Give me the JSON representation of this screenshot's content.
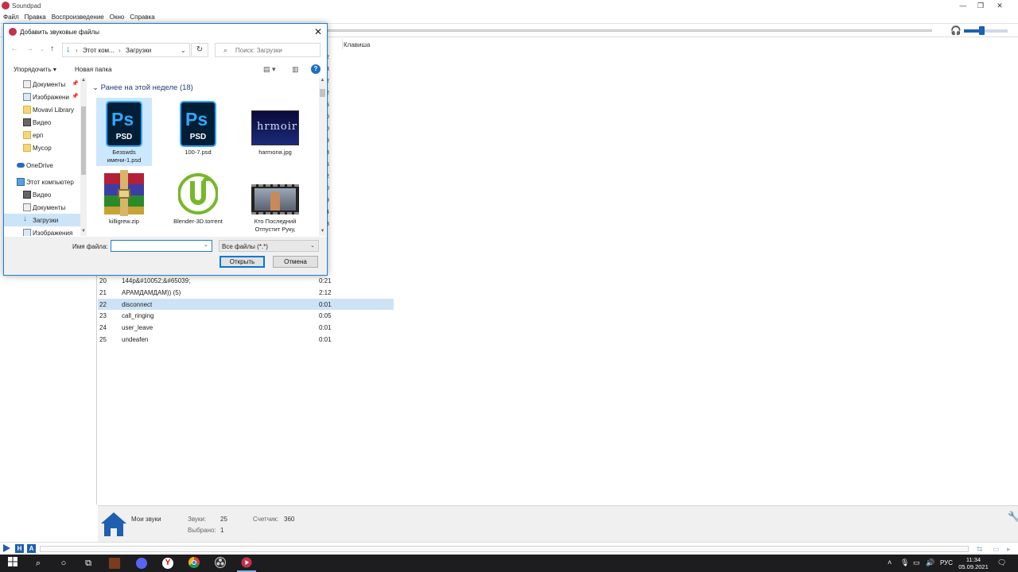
{
  "app": {
    "title": "Soundpad",
    "menu": [
      "Файл",
      "Правка",
      "Воспроизведение",
      "Окно",
      "Справка"
    ],
    "list_columns": {
      "key": "Клавиша"
    },
    "partial_durations": [
      "2",
      "3",
      "2",
      "2",
      "5",
      "0",
      "0",
      "9",
      "3",
      "5",
      "2",
      "0",
      "9",
      "4",
      "3"
    ],
    "rows": [
      {
        "num": "20",
        "name": "144p&#10052;&#65039;",
        "dur": "0:21",
        "selected": false
      },
      {
        "num": "21",
        "name": "АРАМДАМДАМ)) (5)",
        "dur": "2:12",
        "selected": false
      },
      {
        "num": "22",
        "name": "disconnect",
        "dur": "0:01",
        "selected": true
      },
      {
        "num": "23",
        "name": "call_ringing",
        "dur": "0:05",
        "selected": false
      },
      {
        "num": "24",
        "name": "user_leave",
        "dur": "0:01",
        "selected": false
      },
      {
        "num": "25",
        "name": "undeafen",
        "dur": "0:01",
        "selected": false
      }
    ],
    "status": {
      "category": "Мои звуки",
      "sounds_label": "Звуки:",
      "sounds_value": "25",
      "selected_label": "Выбрано:",
      "selected_value": "1",
      "counter_label": "Счетчик:",
      "counter_value": "360"
    },
    "volume": 0.45,
    "bottom_buttons": [
      "H",
      "A"
    ]
  },
  "dialog": {
    "title": "Добавить звуковые файлы",
    "breadcrumb": [
      "Этот ком...",
      "Загрузки"
    ],
    "search_placeholder": "Поиск: Загрузки",
    "organize": "Упорядочить",
    "new_folder": "Новая папка",
    "tree": [
      {
        "label": "Документы",
        "icon": "documents-icon",
        "indent": 1,
        "pinned": true,
        "selected": false
      },
      {
        "label": "Изображени",
        "icon": "pictures-icon",
        "indent": 1,
        "pinned": true,
        "selected": false
      },
      {
        "label": "Movavi Library",
        "icon": "folder-icon",
        "indent": 1,
        "pinned": false,
        "selected": false
      },
      {
        "label": "Видео",
        "icon": "video-icon",
        "indent": 1,
        "pinned": false,
        "selected": false
      },
      {
        "label": "ерп",
        "icon": "folder-icon",
        "indent": 1,
        "pinned": false,
        "selected": false
      },
      {
        "label": "Мусор",
        "icon": "folder-icon",
        "indent": 1,
        "pinned": false,
        "selected": false
      },
      {
        "label": "OneDrive",
        "icon": "cloud-icon",
        "indent": 0,
        "pinned": false,
        "selected": false
      },
      {
        "label": "Этот компьютер",
        "icon": "computer-icon",
        "indent": 0,
        "pinned": false,
        "selected": false
      },
      {
        "label": "Видео",
        "icon": "video-icon",
        "indent": 1,
        "pinned": false,
        "selected": false
      },
      {
        "label": "Документы",
        "icon": "documents-icon",
        "indent": 1,
        "pinned": false,
        "selected": false
      },
      {
        "label": "Загрузки",
        "icon": "downloads-icon",
        "indent": 1,
        "pinned": false,
        "selected": true
      },
      {
        "label": "Изображения",
        "icon": "pictures-icon",
        "indent": 1,
        "pinned": false,
        "selected": false
      }
    ],
    "group_header": "Ранее на этой неделе (18)",
    "files": [
      {
        "name": "Безswds имени-1.psd",
        "icon": "psd-icon",
        "selected": true
      },
      {
        "name": "100-7.psd",
        "icon": "psd-icon",
        "selected": false
      },
      {
        "name": "harmonя.jpg",
        "icon": "image-thumbnail",
        "thumb_text": "hrmoir",
        "selected": false
      },
      {
        "name": "killigrew.zip",
        "icon": "winrar-archive-icon",
        "selected": false
      },
      {
        "name": "Blender-3D.torrent",
        "icon": "utorrent-icon",
        "selected": false
      },
      {
        "name": "Кто Последний Отпустит Руку,",
        "icon": "video-thumbnail",
        "selected": false
      }
    ],
    "filename_label": "Имя файла:",
    "filename_value": "",
    "filter": "Все файлы (*.*)",
    "open_label": "Открыть",
    "cancel_label": "Отмена"
  },
  "taskbar": {
    "language": "РУС",
    "time": "11:34",
    "date": "05.09.2021"
  }
}
